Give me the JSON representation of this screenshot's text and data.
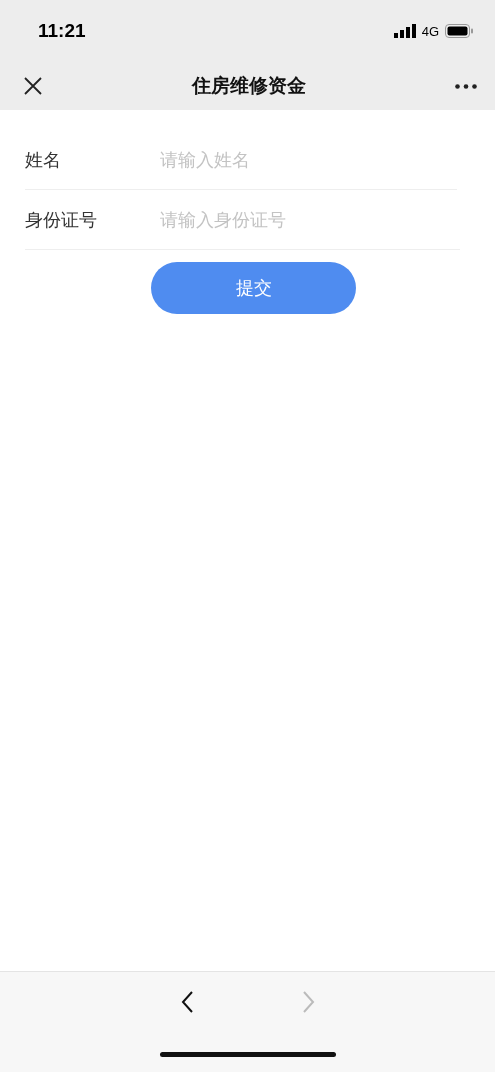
{
  "status_bar": {
    "time": "11:21",
    "network": "4G"
  },
  "nav_bar": {
    "title": "住房维修资金"
  },
  "form": {
    "fields": [
      {
        "label": "姓名",
        "placeholder": "请输入姓名"
      },
      {
        "label": "身份证号",
        "placeholder": "请输入身份证号"
      }
    ],
    "submit": "提交"
  },
  "toolbar": {
    "back_disabled": false,
    "forward_disabled": true
  }
}
